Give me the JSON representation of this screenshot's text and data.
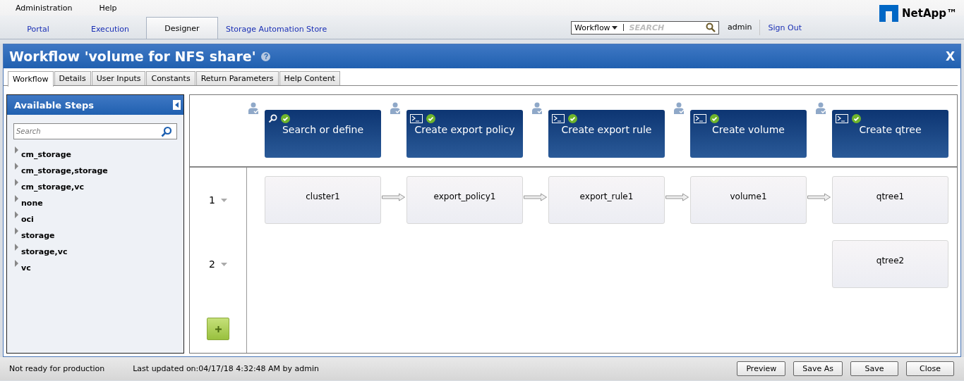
{
  "menu": [
    "Administration",
    "Help"
  ],
  "logo": {
    "text": "NetApp™"
  },
  "nav_tabs": [
    {
      "label": "Portal",
      "selected": false
    },
    {
      "label": "Execution",
      "selected": false
    },
    {
      "label": "Designer",
      "selected": true
    },
    {
      "label": "Storage Automation Store",
      "selected": false
    }
  ],
  "search": {
    "scope": "Workflow",
    "placeholder": "SEARCH"
  },
  "user": "admin",
  "sign_out": "Sign Out",
  "dialog": {
    "title": "Workflow 'volume for NFS share'",
    "help": "?",
    "close": "X"
  },
  "tabs": [
    {
      "label": "Workflow",
      "selected": true
    },
    {
      "label": "Details",
      "selected": false
    },
    {
      "label": "User Inputs",
      "selected": false
    },
    {
      "label": "Constants",
      "selected": false
    },
    {
      "label": "Return Parameters",
      "selected": false
    },
    {
      "label": "Help Content",
      "selected": false
    }
  ],
  "sidebar": {
    "title": "Available Steps",
    "search_placeholder": "Search",
    "items": [
      {
        "label": "cm_storage",
        "expanded": false
      },
      {
        "label": "cm_storage,storage",
        "expanded": false
      },
      {
        "label": "cm_storage,vc",
        "expanded": false
      },
      {
        "label": "none",
        "expanded": false
      },
      {
        "label": "oci",
        "expanded": false
      },
      {
        "label": "storage",
        "expanded": false
      },
      {
        "label": "storage,vc",
        "expanded": false
      },
      {
        "label": "vc",
        "expanded": false
      }
    ]
  },
  "steps": [
    {
      "title": "Search or define",
      "kind": "search",
      "valid": true
    },
    {
      "title": "Create export policy",
      "kind": "command",
      "valid": true
    },
    {
      "title": "Create export rule",
      "kind": "command",
      "valid": true
    },
    {
      "title": "Create volume",
      "kind": "command",
      "valid": true
    },
    {
      "title": "Create qtree",
      "kind": "command",
      "valid": true
    }
  ],
  "rows": [
    {
      "number": "1",
      "cells": [
        "cluster1",
        "export_policy1",
        "export_rule1",
        "volume1",
        "qtree1"
      ]
    },
    {
      "number": "2",
      "cells": [
        null,
        null,
        null,
        null,
        "qtree2"
      ]
    }
  ],
  "status_bar": {
    "state": "Not ready for production",
    "updated": "Last updated on:04/17/18 4:32:48 AM by admin",
    "buttons": [
      "Preview",
      "Save As",
      "Save",
      "Close"
    ]
  }
}
